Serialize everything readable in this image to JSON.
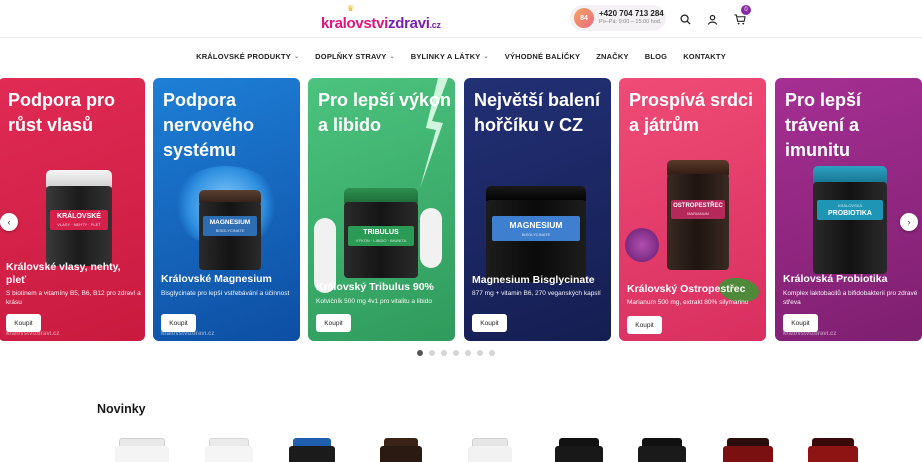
{
  "header": {
    "logo_part1": "kralovstvi",
    "logo_part2": "zdravi",
    "logo_tld": ".cz",
    "phone_avatar": "84",
    "phone": "+420 704 713 284",
    "hours": "Po–Pá: 9:00 – 15:00 hod.",
    "cart_count": "0",
    "icons": [
      "search-icon",
      "user-icon",
      "cart-icon"
    ]
  },
  "nav": {
    "items": [
      {
        "label": "KRÁLOVSKÉ PRODUKTY",
        "has_dropdown": true
      },
      {
        "label": "DOPLŇKY STRAVY",
        "has_dropdown": true
      },
      {
        "label": "BYLINKY A LÁTKY",
        "has_dropdown": true
      },
      {
        "label": "VÝHODNÉ BALÍČKY",
        "has_dropdown": false
      },
      {
        "label": "ZNAČKY",
        "has_dropdown": false
      },
      {
        "label": "BLOG",
        "has_dropdown": false
      },
      {
        "label": "KONTAKTY",
        "has_dropdown": false
      }
    ]
  },
  "slides": [
    {
      "title": "Podpora pro růst vlasů",
      "name": "Královské vlasy, nehty, pleť",
      "desc": "S biotinem a vitamíny B5, B6, B12 pro zdraví a krásu",
      "button": "Koupit",
      "jar_label": "KRÁLOVSKÉ",
      "jar_sub": "VLASY · NEHTY · PLEŤ",
      "bg": "#d7234a"
    },
    {
      "title": "Podpora nervového systému",
      "name": "Královské Magnesium",
      "desc": "Bisglycinate pro lepší vstřebávání a účinnost",
      "button": "Koupit",
      "jar_label": "MAGNESIUM",
      "jar_sub": "BISGLYCINATE",
      "bg": "#1565c0"
    },
    {
      "title": "Pro lepší výkon a libido",
      "name": "Královský Tribulus 90%",
      "desc": "Kotvičník 500 mg 4v1 pro vitalitu a libido",
      "button": "Koupit",
      "jar_label": "TRIBULUS",
      "jar_sub": "VÝKON · LIBIDO · IMUNITA",
      "bg": "#3aa66a"
    },
    {
      "title": "Největší balení hořčíku v CZ",
      "name": "Magnesium Bisglycinate",
      "desc": "877 mg + vitamin B6, 270 veganských kapslí",
      "button": "Koupit",
      "jar_label": "MAGNESIUM",
      "jar_sub": "BISGLYCINATE",
      "bg": "#1f2a6b"
    },
    {
      "title": "Prospívá srdci a játrům",
      "name": "Královský Ostropestřec",
      "desc": "Marianum 500 mg, extrakt 80% silymarinu",
      "button": "Koupit",
      "jar_label": "OSTROPESTŘEC",
      "jar_sub": "MARIANUM",
      "bg": "#e2416d"
    },
    {
      "title": "Pro lepší trávení a imunitu",
      "name": "Královská Probiotika",
      "desc": "Komplex laktobacilů a bifidobakterií pro zdravé střeva",
      "button": "Koupit",
      "jar_label": "PROBIOTIKA",
      "jar_sub": "KRÁLOVSKÁ",
      "bg": "#9b2a8a"
    }
  ],
  "carousel": {
    "prev_icon": "chevron-left-icon",
    "next_icon": "chevron-right-icon",
    "dot_count": 7,
    "active_dot": 0,
    "watermark": "kralovstvizdravi.cz"
  },
  "section": {
    "title": "Novinky"
  }
}
